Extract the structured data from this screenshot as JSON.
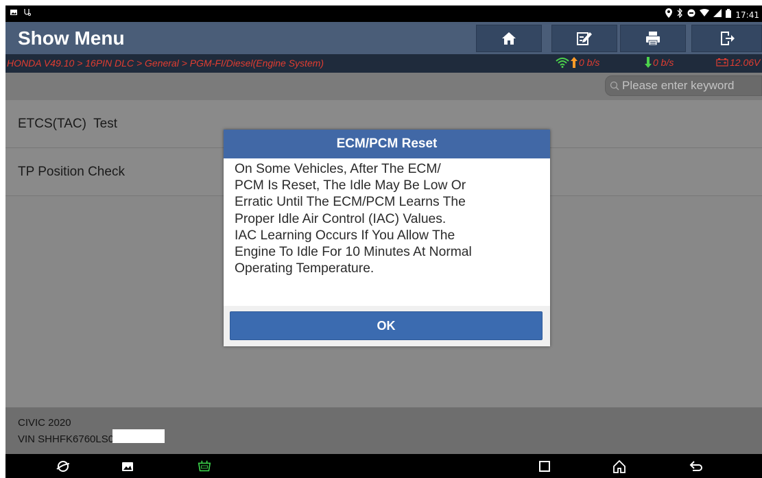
{
  "statusbar": {
    "time": "17:41"
  },
  "appbar": {
    "title": "Show Menu",
    "buttons": [
      "home-icon",
      "edit-icon",
      "print-icon",
      "exit-icon"
    ]
  },
  "breadcrumb": {
    "path": "HONDA V49.10 > 16PIN DLC > General > PGM-FI/Diesel(Engine System)",
    "upload_rate": "0 b/s",
    "download_rate": "0 b/s",
    "voltage": "12.06V"
  },
  "search": {
    "placeholder": "Please enter keyword"
  },
  "menu": {
    "items": [
      {
        "label": "ETCS(TAC)  Test"
      },
      {
        "label": "TP Position Check"
      }
    ]
  },
  "vehicle": {
    "model": "CIVIC 2020",
    "vin": "VIN SHHFK6760LS000380"
  },
  "dialog": {
    "title": "ECM/PCM Reset",
    "message": "On Some Vehicles, After The ECM/\nPCM Is Reset, The Idle May Be Low Or\nErratic Until The ECM/PCM Learns The\nProper Idle Air Control (IAC) Values.\nIAC Learning Occurs If You Allow The\nEngine To Idle For 10 Minutes At Normal\nOperating Temperature.",
    "ok_label": "OK"
  },
  "colors": {
    "appbar": "#4a5d78",
    "breadcrumb_text": "#e23d31",
    "dialog_header": "#4168a6",
    "ok_button": "#3b6bb0"
  }
}
